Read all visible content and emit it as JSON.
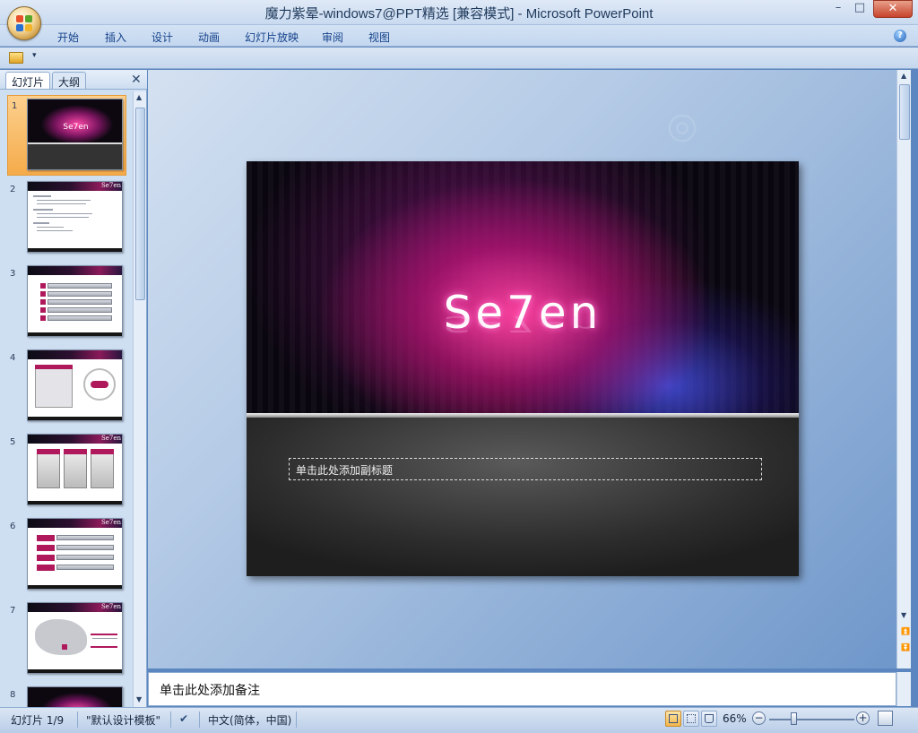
{
  "window": {
    "title": "魔力紫晕-windows7@PPT精选 [兼容模式] - Microsoft PowerPoint",
    "minimize": "–",
    "maximize": "□",
    "close": "✕"
  },
  "ribbon": {
    "tabs": [
      "开始",
      "插入",
      "设计",
      "动画",
      "幻灯片放映",
      "审阅",
      "视图"
    ],
    "help": "?"
  },
  "qat": {
    "dropdown": "▾"
  },
  "left_pane": {
    "tab_slides": "幻灯片",
    "tab_outline": "大纲",
    "close": "✕",
    "thumbnails": [
      "1",
      "2",
      "3",
      "4",
      "5",
      "6",
      "7",
      "8"
    ],
    "thumb_logo": "Se7en",
    "selected": "1"
  },
  "slide": {
    "logo": "Se7en",
    "subtitle_placeholder": "单击此处添加副标题"
  },
  "notes": {
    "placeholder": "单击此处添加备注"
  },
  "status": {
    "slide_info": "幻灯片 1/9",
    "theme": "\"默认设计模板\"",
    "language": "中文(简体，中国)",
    "zoom": "66%",
    "zoom_minus": "−",
    "zoom_plus": "+"
  }
}
